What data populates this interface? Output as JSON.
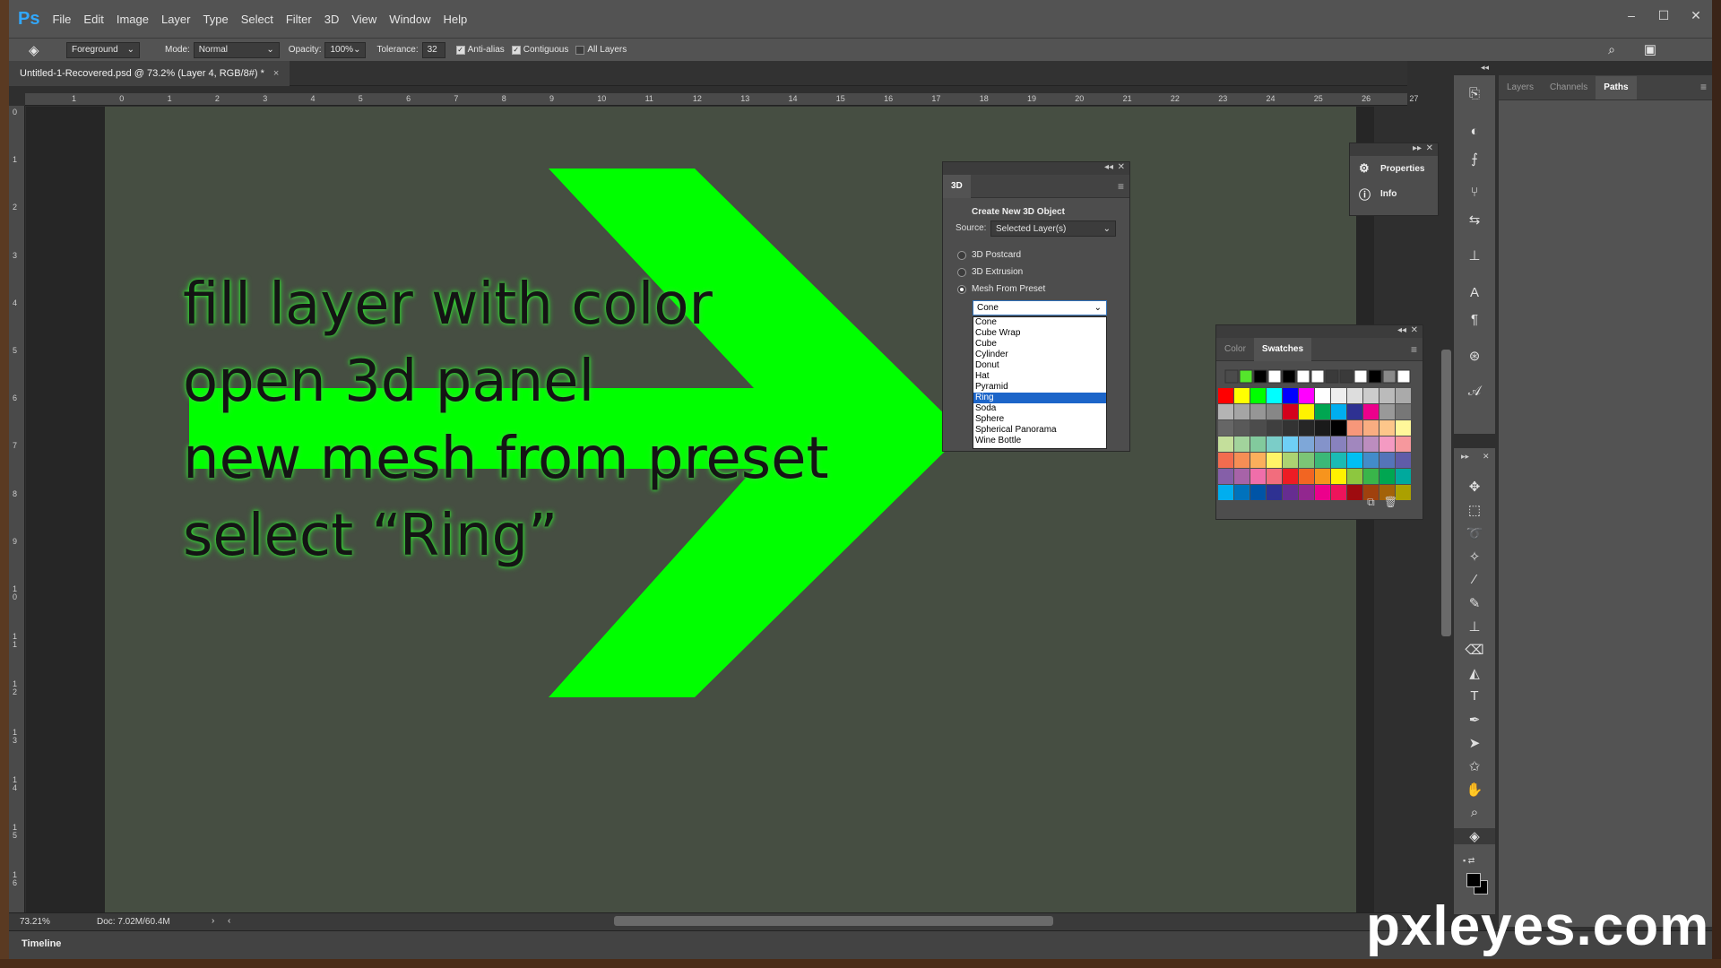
{
  "app": {
    "logo": "Ps",
    "menu": [
      "File",
      "Edit",
      "Image",
      "Layer",
      "Type",
      "Select",
      "Filter",
      "3D",
      "View",
      "Window",
      "Help"
    ],
    "window_controls": {
      "minimize": "–",
      "maximize": "☐",
      "close": "✕"
    }
  },
  "options": {
    "fill_source": "Foreground",
    "mode_label": "Mode:",
    "mode_value": "Normal",
    "opacity_label": "Opacity:",
    "opacity_value": "100%",
    "tolerance_label": "Tolerance:",
    "tolerance_value": "32",
    "anti_alias": "Anti-alias",
    "contiguous": "Contiguous",
    "all_layers": "All Layers"
  },
  "document": {
    "tab_title": "Untitled-1-Recovered.psd @ 73.2% (Layer 4, RGB/8#) *",
    "tab_close": "×",
    "zoom": "73.21%",
    "doc_size": "Doc: 7.02M/60.4M"
  },
  "rulers": {
    "h": [
      "1",
      "0",
      "1",
      "2",
      "3",
      "4",
      "5",
      "6",
      "7",
      "8",
      "9",
      "10",
      "11",
      "12",
      "13",
      "14",
      "15",
      "16",
      "17",
      "18",
      "19",
      "20",
      "21",
      "22",
      "23",
      "24",
      "25",
      "26",
      "27"
    ],
    "v": [
      "0",
      "1",
      "2",
      "3",
      "4",
      "5",
      "6",
      "7",
      "8",
      "9",
      "1 0",
      "1 1",
      "1 2",
      "1 3",
      "1 4",
      "1 5",
      "1 6"
    ]
  },
  "canvas": {
    "instructions": [
      "fill layer with color",
      "open 3d panel",
      "new mesh from preset",
      "select “Ring”"
    ],
    "arrow_color": "#00ff00",
    "bg_color": "#464e42"
  },
  "panel_3d": {
    "tab": "3D",
    "heading": "Create New 3D Object",
    "source_label": "Source:",
    "source_value": "Selected Layer(s)",
    "options": [
      "3D Postcard",
      "3D Extrusion",
      "Mesh From Preset"
    ],
    "selected_option": 2,
    "preset_selected": "Cone",
    "presets": [
      "Cone",
      "Cube Wrap",
      "Cube",
      "Cylinder",
      "Donut",
      "Hat",
      "Pyramid",
      "Ring",
      "Soda",
      "Sphere",
      "Spherical Panorama",
      "Wine Bottle"
    ],
    "highlighted_preset": "Ring"
  },
  "panel_props": {
    "items": [
      "Properties",
      "Info"
    ]
  },
  "panel_swatches": {
    "tabs": [
      "Color",
      "Swatches"
    ],
    "active_tab": "Swatches",
    "top_row": [
      "#4b4b4b",
      "#55e62c",
      "#000000",
      "#ffffff",
      "#000000",
      "#ffffff",
      "#ffffff",
      "#3a3a3a",
      "#3a3a3a",
      "#ffffff",
      "#000000",
      "#8a8a8a",
      "#ffffff"
    ],
    "rows": [
      [
        "#ff0000",
        "#ffff00",
        "#00ff00",
        "#00ffff",
        "#0000ff",
        "#ff00ff",
        "#ffffff",
        "#eeeeee",
        "#dddddd",
        "#cccccc",
        "#bbbbbb",
        "#aaaaaa"
      ],
      [
        "#b4b4b4",
        "#a5a5a5",
        "#969696",
        "#878787",
        "#d4001c",
        "#fff200",
        "#00a651",
        "#00aeef",
        "#2e3192",
        "#ec008c",
        "#999999",
        "#777777"
      ],
      [
        "#666666",
        "#595959",
        "#4c4c4c",
        "#3f3f3f",
        "#333333",
        "#262626",
        "#1a1a1a",
        "#000000",
        "#f7977a",
        "#f9ad81",
        "#fdc68a",
        "#fff79a"
      ],
      [
        "#c4df9b",
        "#a2d39c",
        "#82ca9d",
        "#7bcdc8",
        "#6ecff6",
        "#7ea7d8",
        "#8493ca",
        "#8882be",
        "#a187be",
        "#bc8dbf",
        "#f49ac2",
        "#f6989d"
      ],
      [
        "#f26c4f",
        "#f68e55",
        "#fbaf5c",
        "#fff467",
        "#acd372",
        "#7cc576",
        "#3bb878",
        "#1abbb4",
        "#00bff3",
        "#438cca",
        "#5574b9",
        "#605ca8"
      ],
      [
        "#855fa8",
        "#a763a8",
        "#f06eaa",
        "#f26d7d",
        "#ed1c24",
        "#f26522",
        "#f7941d",
        "#fff200",
        "#8dc73f",
        "#39b54a",
        "#00a651",
        "#00a99d"
      ],
      [
        "#00aeef",
        "#0072bc",
        "#0054a6",
        "#2e3192",
        "#662d91",
        "#92278f",
        "#ec008c",
        "#ed145b",
        "#9e0b0f",
        "#a0410d",
        "#a36209",
        "#aba000"
      ]
    ]
  },
  "right_dock": {
    "tabs": [
      "Layers",
      "Channels",
      "Paths"
    ],
    "active_tab": "Paths"
  },
  "timeline": {
    "label": "Timeline"
  },
  "watermark": "pxleyes.com"
}
